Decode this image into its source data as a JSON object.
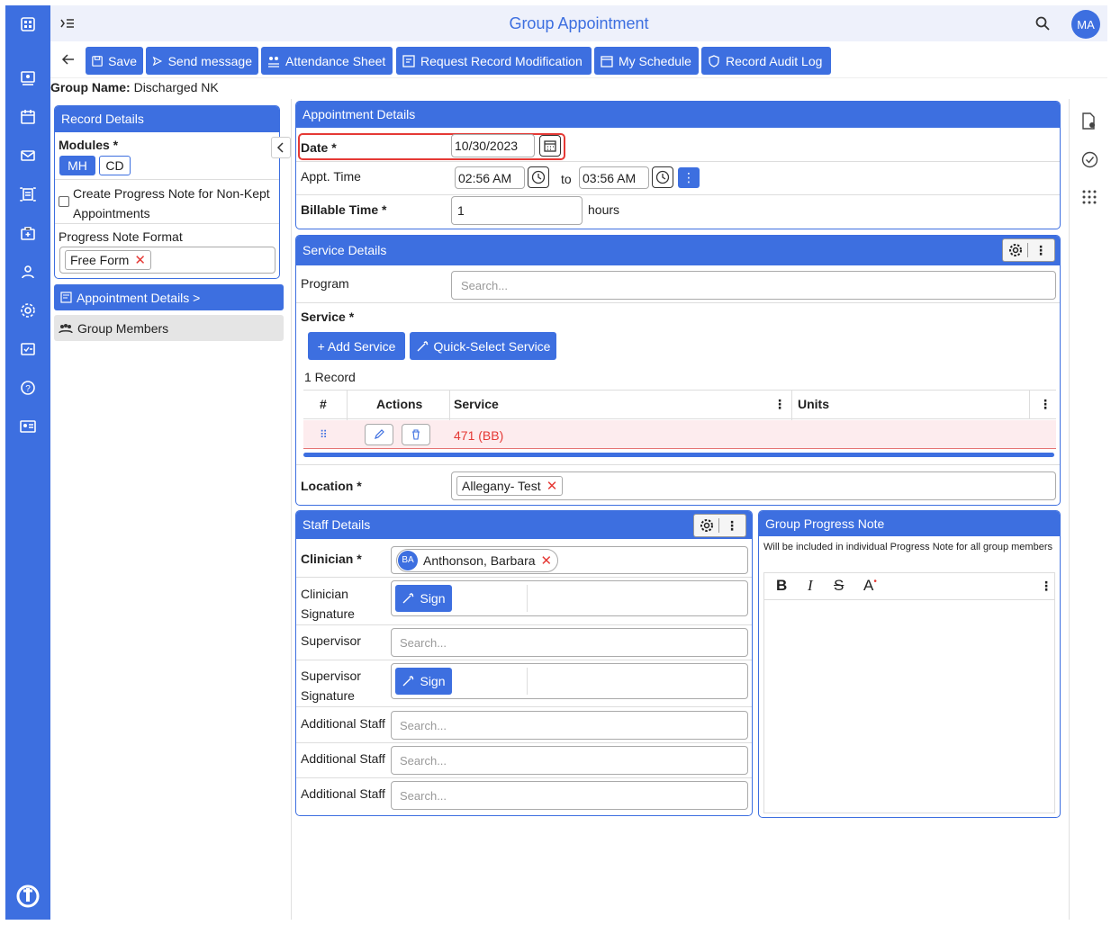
{
  "header": {
    "title": "Group Appointment",
    "user_initials": "MA"
  },
  "toolbar": {
    "save": "Save",
    "send_message": "Send message",
    "attendance_sheet": "Attendance Sheet",
    "request_record_modification": "Request Record Modification",
    "my_schedule": "My Schedule",
    "record_audit_log": "Record Audit Log"
  },
  "group": {
    "name_label": "Group Name:",
    "name_value": "Discharged NK"
  },
  "record_details": {
    "title": "Record Details",
    "modules_label": "Modules *",
    "modules": [
      "MH",
      "CD"
    ],
    "create_note_label": "Create Progress Note for Non-Kept Appointments",
    "format_label": "Progress Note Format",
    "format_value": "Free Form"
  },
  "nav": {
    "appointment_details": "Appointment Details >",
    "group_members": "Group Members"
  },
  "appointment": {
    "title": "Appointment Details",
    "date_label": "Date *",
    "date_value": "10/30/2023",
    "time_label": "Appt. Time",
    "start_time": "02:56 AM",
    "to_label": "to",
    "end_time": "03:56 AM",
    "billable_label": "Billable Time *",
    "billable_value": "1",
    "hours_label": "hours"
  },
  "service": {
    "title": "Service Details",
    "program_label": "Program",
    "program_placeholder": "Search...",
    "service_label": "Service *",
    "add_service": "+ Add Service",
    "quick_select": "Quick-Select Service",
    "record_count": "1 Record",
    "columns": [
      "#",
      "Actions",
      "Service",
      "Units"
    ],
    "rows": [
      {
        "service": "471 (BB)",
        "units": ""
      }
    ],
    "location_label": "Location *",
    "location_value": "Allegany- Test"
  },
  "staff": {
    "title": "Staff Details",
    "clinician_label": "Clinician *",
    "clinician_initials": "BA",
    "clinician_value": "Anthonson, Barbara",
    "clinician_sig_label": "Clinician Signature",
    "sign": "Sign",
    "supervisor_label": "Supervisor",
    "supervisor_sig_label": "Supervisor Signature",
    "additional_label": "Additional Staff",
    "placeholder": "Search..."
  },
  "progress_note": {
    "title": "Group Progress Note",
    "hint": "Will be included in individual Progress Note for all group members"
  },
  "colors": {
    "primary": "#3d6fe0",
    "error": "#e53935",
    "row_highlight": "#fdecee"
  }
}
